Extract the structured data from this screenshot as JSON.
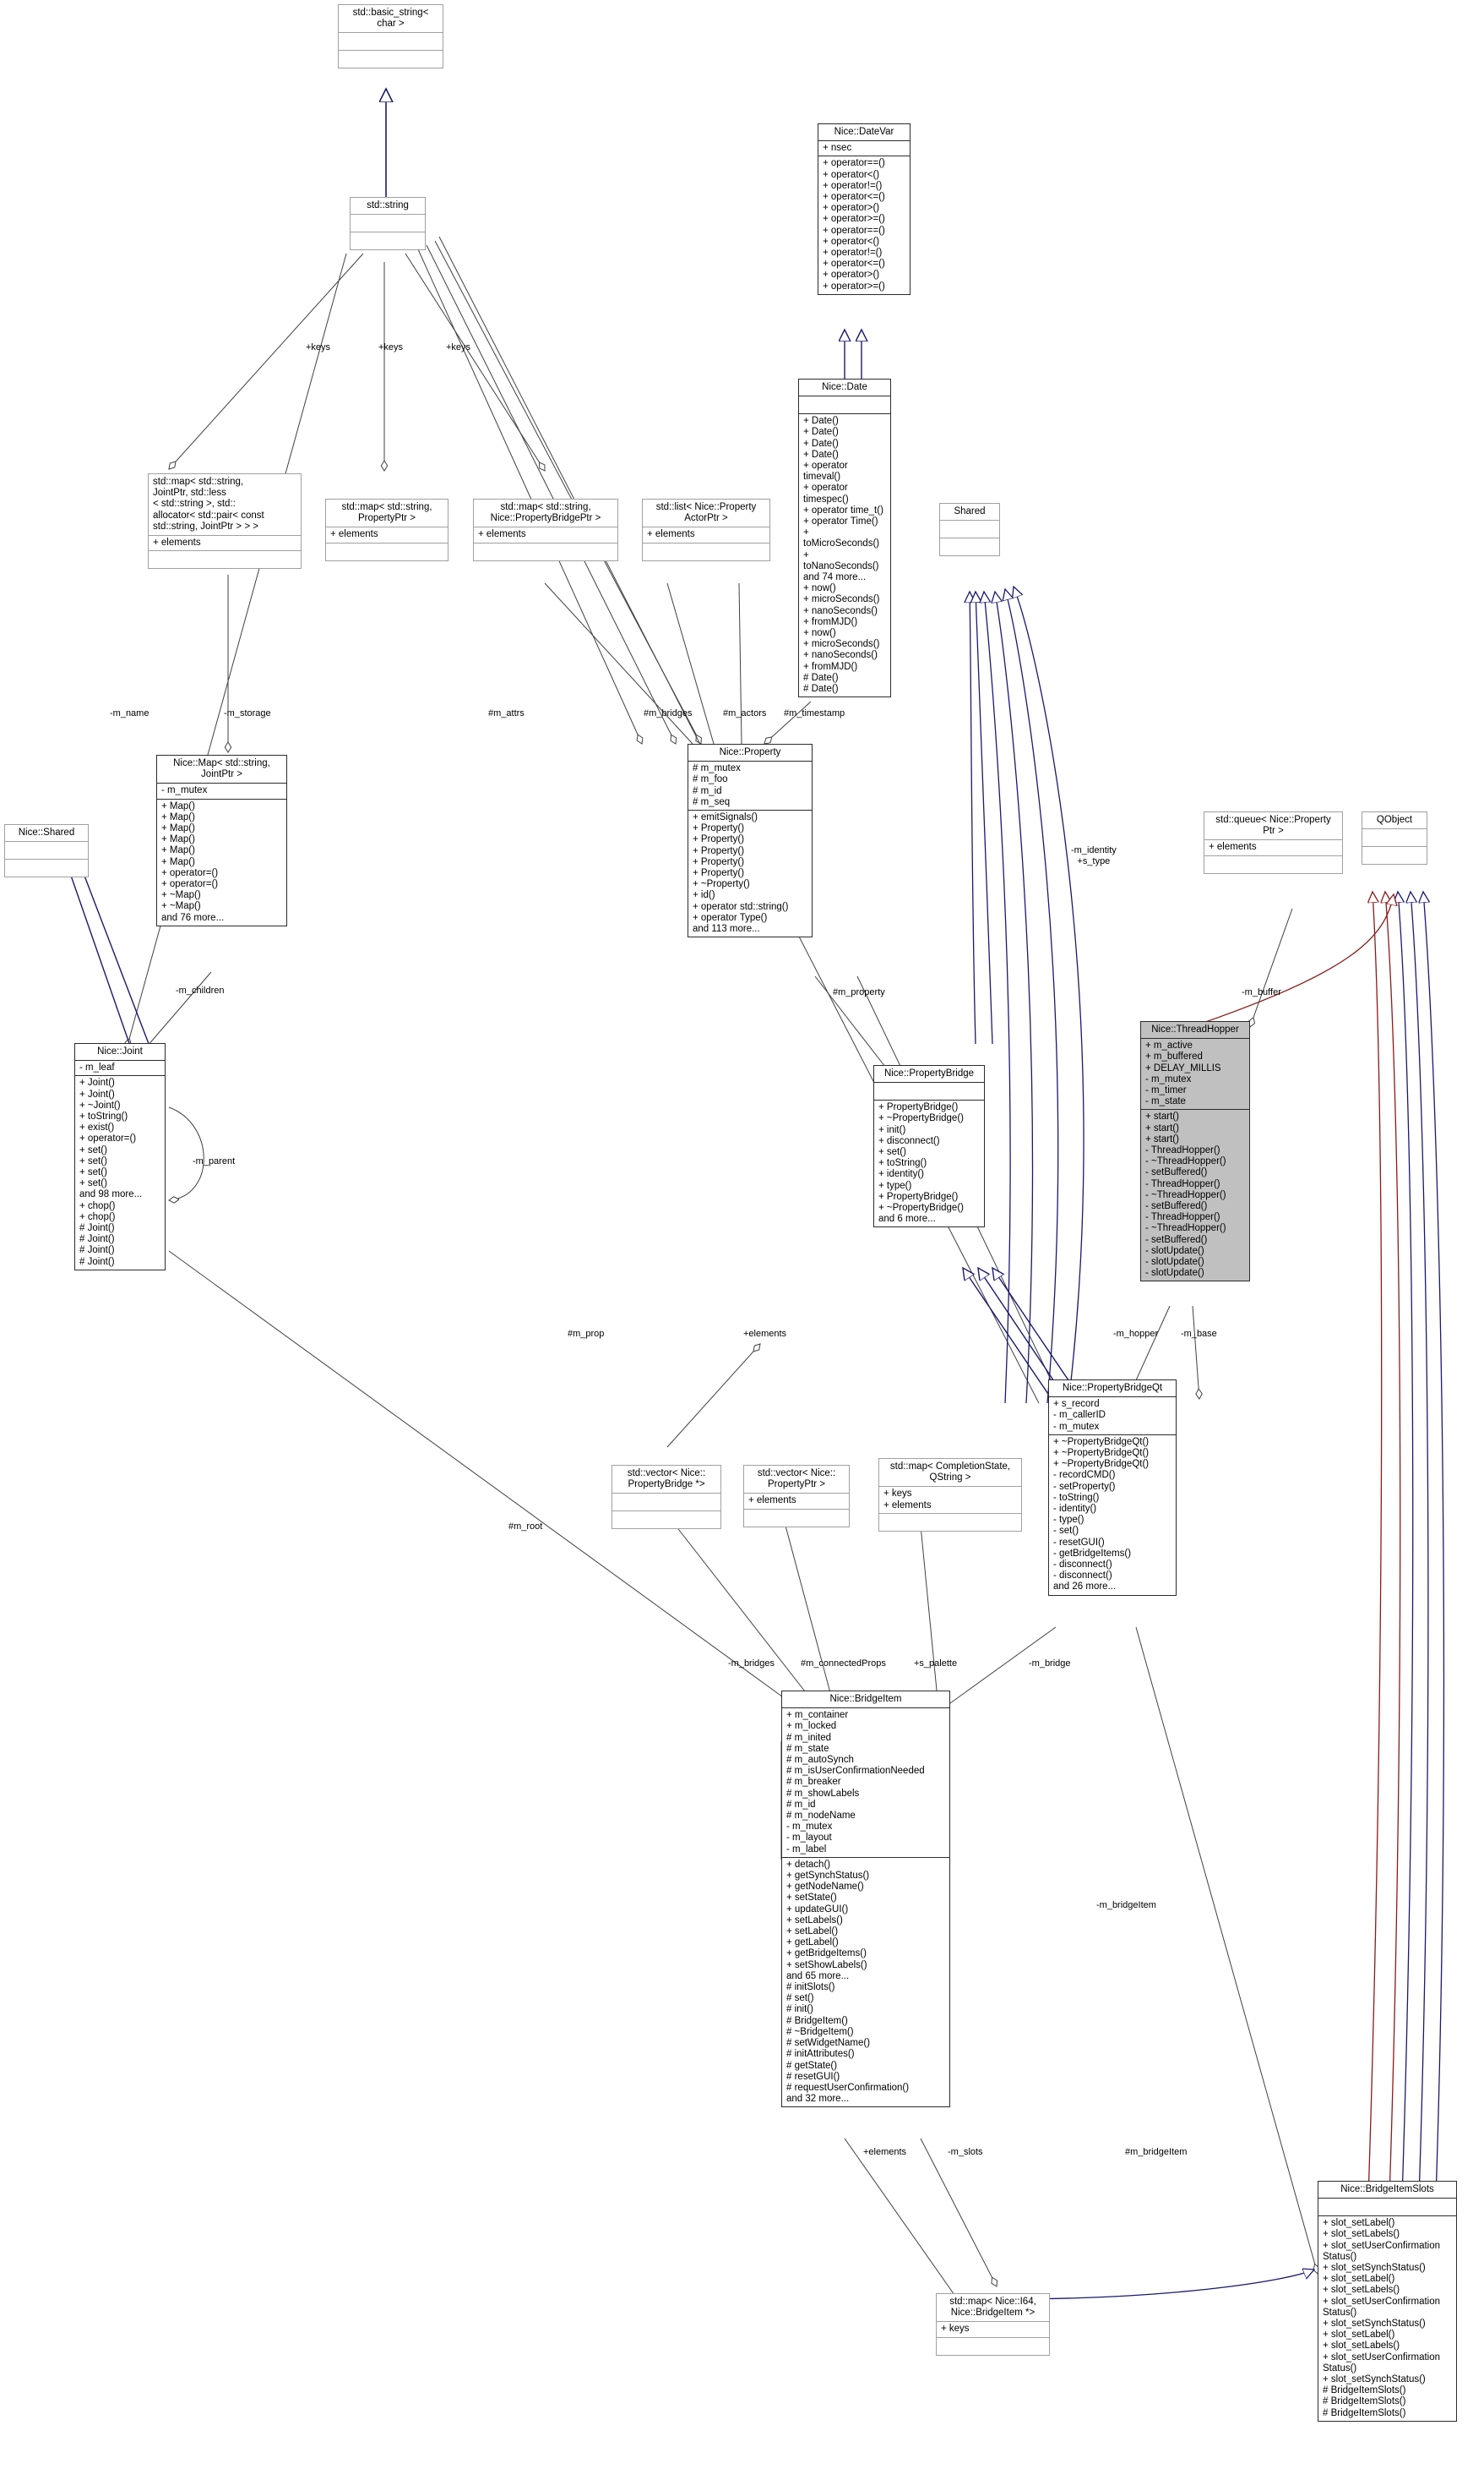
{
  "diagram": {
    "kind": "uml-class-diagram",
    "colors": {
      "inherit_arrow": "#191970",
      "qobject_arrow": "#8b1a1a",
      "aggregation_line": "#404040",
      "node_border_light": "#a0a0a0",
      "node_border_strong": "#2b2b2b",
      "node_fill_highlight": "#c0c0c0",
      "background": "#ffffff"
    }
  },
  "nodes": [
    {
      "id": "basic_string",
      "title": "std::basic_string<\nchar >",
      "attrs": "",
      "ops": ""
    },
    {
      "id": "std_string",
      "title": "std::string",
      "attrs": "",
      "ops": ""
    },
    {
      "id": "datevar",
      "title": "Nice::DateVar",
      "attrs": "+ nsec",
      "ops": "+ operator==()\n+ operator<()\n+ operator!=()\n+ operator<=()\n+ operator>()\n+ operator>=()\n+ operator==()\n+ operator<()\n+ operator!=()\n+ operator<=()\n+ operator>()\n+ operator>=()"
    },
    {
      "id": "date",
      "title": "Nice::Date",
      "attrs": "",
      "ops": "+ Date()\n+ Date()\n+ Date()\n+ Date()\n+ operator timeval()\n+ operator timespec()\n+ operator time_t()\n+ operator Time()\n+ toMicroSeconds()\n+ toNanoSeconds()\nand 74 more...\n+ now()\n+ microSeconds()\n+ nanoSeconds()\n+ fromMJD()\n+ now()\n+ microSeconds()\n+ nanoSeconds()\n+ fromMJD()\n# Date()\n# Date()"
    },
    {
      "id": "map_string_jointptr",
      "title": "std::map< std::string,\n JointPtr, std::less\n< std::string >, std::\nallocator< std::pair< const\n std::string, JointPtr > > >",
      "attrs": "+ elements",
      "ops": ""
    },
    {
      "id": "map_string_propertyptr",
      "title": "std::map< std::string,\nPropertyPtr >",
      "attrs": "+ elements",
      "ops": ""
    },
    {
      "id": "map_string_bridgeptr",
      "title": "std::map< std::string,\nNice::PropertyBridgePtr >",
      "attrs": "+ elements",
      "ops": ""
    },
    {
      "id": "list_actorptr",
      "title": "std::list< Nice::Property\nActorPtr >",
      "attrs": "+ elements",
      "ops": ""
    },
    {
      "id": "shared_plain",
      "title": "Shared",
      "attrs": "",
      "ops": ""
    },
    {
      "id": "nice_shared",
      "title": "Nice::Shared",
      "attrs": "",
      "ops": ""
    },
    {
      "id": "nice_map",
      "title": "Nice::Map< std::string,\nJointPtr >",
      "attrs": "- m_mutex",
      "ops": "+ Map()\n+ Map()\n+ Map()\n+ Map()\n+ Map()\n+ Map()\n+ operator=()\n+ operator=()\n+ ~Map()\n+ ~Map()\nand 76 more..."
    },
    {
      "id": "nice_joint",
      "title": "Nice::Joint",
      "attrs": "- m_leaf",
      "ops": "+ Joint()\n+ Joint()\n+ ~Joint()\n+ toString()\n+ exist()\n+ operator=()\n+ set()\n+ set()\n+ set()\n+ set()\nand 98 more...\n+ chop()\n+ chop()\n# Joint()\n# Joint()\n# Joint()\n# Joint()"
    },
    {
      "id": "nice_property",
      "title": "Nice::Property",
      "attrs": "# m_mutex\n# m_foo\n# m_id\n# m_seq",
      "ops": "+ emitSignals()\n+ Property()\n+ Property()\n+ Property()\n+ Property()\n+ Property()\n+ ~Property()\n+ id()\n+ operator std::string()\n+ operator Type()\nand 113 more..."
    },
    {
      "id": "queue_propertyptr",
      "title": "std::queue< Nice::Property\nPtr >",
      "attrs": "+ elements",
      "ops": ""
    },
    {
      "id": "qobject",
      "title": "QObject",
      "attrs": "",
      "ops": ""
    },
    {
      "id": "propertybridge",
      "title": "Nice::PropertyBridge",
      "attrs": "",
      "ops": "+ PropertyBridge()\n+ ~PropertyBridge()\n+ init()\n+ disconnect()\n+ set()\n+ toString()\n+ identity()\n+ type()\n+ PropertyBridge()\n+ ~PropertyBridge()\nand 6 more..."
    },
    {
      "id": "threadhopper",
      "title": "Nice::ThreadHopper",
      "attrs": "+ m_active\n+ m_buffered\n+ DELAY_MILLIS\n- m_mutex\n- m_timer\n- m_state",
      "ops": "+ start()\n+ start()\n+ start()\n- ThreadHopper()\n- ~ThreadHopper()\n- setBuffered()\n- ThreadHopper()\n- ~ThreadHopper()\n- setBuffered()\n- ThreadHopper()\n- ~ThreadHopper()\n- setBuffered()\n- slotUpdate()\n- slotUpdate()\n- slotUpdate()"
    },
    {
      "id": "propertybridgeqt",
      "title": "Nice::PropertyBridgeQt",
      "attrs": "+ s_record\n- m_callerID\n- m_mutex",
      "ops": "+ ~PropertyBridgeQt()\n+ ~PropertyBridgeQt()\n+ ~PropertyBridgeQt()\n- recordCMD()\n- setProperty()\n- toString()\n- identity()\n- type()\n- set()\n- resetGUI()\n- getBridgeItems()\n- disconnect()\n- disconnect()\nand 26 more..."
    },
    {
      "id": "vector_bridge_ptr",
      "title": "std::vector< Nice::\nPropertyBridge *>",
      "attrs": "",
      "ops": ""
    },
    {
      "id": "vector_propertyptr",
      "title": "std::vector< Nice::\nPropertyPtr >",
      "attrs": "+ elements",
      "ops": ""
    },
    {
      "id": "map_completionstate",
      "title": "std::map< CompletionState,\nQString >",
      "attrs": "+ keys\n+ elements",
      "ops": ""
    },
    {
      "id": "bridgeitem",
      "title": "Nice::BridgeItem",
      "attrs": "+ m_container\n+ m_locked\n# m_inited\n# m_state\n# m_autoSynch\n# m_isUserConfirmationNeeded\n# m_breaker\n# m_showLabels\n# m_id\n# m_nodeName\n- m_mutex\n- m_layout\n- m_label",
      "ops": "+ detach()\n+ getSynchStatus()\n+ getNodeName()\n+ setState()\n+ updateGUI()\n+ setLabels()\n+ setLabel()\n+ getLabel()\n+ getBridgeItems()\n+ setShowLabels()\nand 65 more...\n# initSlots()\n# set()\n# init()\n# BridgeItem()\n# ~BridgeItem()\n# setWidgetName()\n# initAttributes()\n# getState()\n# resetGUI()\n# requestUserConfirmation()\nand 32 more..."
    },
    {
      "id": "map_int64_bridgeitem",
      "title": "std::map< Nice::I64,\nNice::BridgeItem *>",
      "attrs": "+ keys",
      "ops": ""
    },
    {
      "id": "bridgeitemslots",
      "title": "Nice::BridgeItemSlots",
      "attrs": "",
      "ops": "+ slot_setLabel()\n+ slot_setLabels()\n+ slot_setUserConfirmation\nStatus()\n+ slot_setSynchStatus()\n+ slot_setLabel()\n+ slot_setLabels()\n+ slot_setUserConfirmation\nStatus()\n+ slot_setSynchStatus()\n+ slot_setLabel()\n+ slot_setLabels()\n+ slot_setUserConfirmation\nStatus()\n+ slot_setSynchStatus()\n# BridgeItemSlots()\n# BridgeItemSlots()\n# BridgeItemSlots()"
    }
  ],
  "edge_labels": [
    {
      "id": "keys1",
      "text": "+keys"
    },
    {
      "id": "keys2",
      "text": "+keys"
    },
    {
      "id": "keys3",
      "text": "+keys"
    },
    {
      "id": "m_name",
      "text": "-m_name"
    },
    {
      "id": "m_storage",
      "text": "-m_storage"
    },
    {
      "id": "m_attrs",
      "text": "#m_attrs"
    },
    {
      "id": "m_bridges_top",
      "text": "#m_bridges"
    },
    {
      "id": "m_actors",
      "text": "#m_actors"
    },
    {
      "id": "m_timestamp",
      "text": "#m_timestamp"
    },
    {
      "id": "m_children",
      "text": "-m_children"
    },
    {
      "id": "m_parent",
      "text": "-m_parent"
    },
    {
      "id": "m_identity_s_type",
      "text": "-m_identity\n+s_type"
    },
    {
      "id": "m_property",
      "text": "#m_property"
    },
    {
      "id": "m_buffer",
      "text": "-m_buffer"
    },
    {
      "id": "m_hopper",
      "text": "-m_hopper"
    },
    {
      "id": "m_base",
      "text": "-m_base"
    },
    {
      "id": "m_prop",
      "text": "#m_prop"
    },
    {
      "id": "elements_mid",
      "text": "+elements"
    },
    {
      "id": "m_root",
      "text": "#m_root"
    },
    {
      "id": "m_bridges_low",
      "text": "-m_bridges"
    },
    {
      "id": "m_connectedProps",
      "text": "#m_connectedProps"
    },
    {
      "id": "s_palette",
      "text": "+s_palette"
    },
    {
      "id": "m_bridge",
      "text": "-m_bridge"
    },
    {
      "id": "m_bridgeitem_right",
      "text": "-m_bridgeItem"
    },
    {
      "id": "elements_low",
      "text": "+elements"
    },
    {
      "id": "m_slots",
      "text": "-m_slots"
    },
    {
      "id": "m_bridgeitem_low",
      "text": "#m_bridgeItem"
    }
  ]
}
